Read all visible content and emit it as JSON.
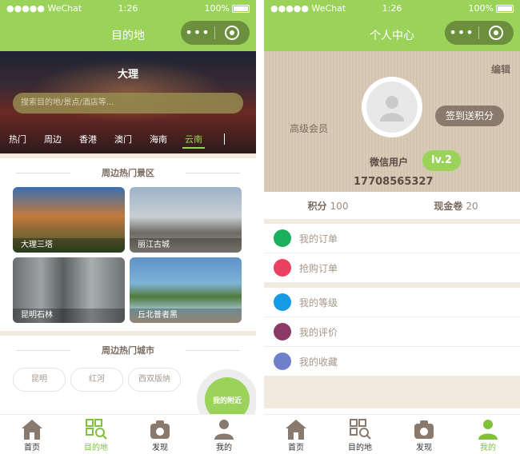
{
  "status": {
    "carrier": "●●●●● WeChat",
    "time": "1:26",
    "battery": "100%"
  },
  "capsule": {
    "more": "•••"
  },
  "screen1": {
    "nav_title": "目的地",
    "hero": {
      "city": "大理",
      "search_placeholder": "搜索目的地/景点/酒店等...",
      "tabs": [
        "热门",
        "周边",
        "香港",
        "澳门",
        "海南",
        "云南"
      ],
      "active_tab": "云南"
    },
    "scenic_title": "周边热门景区",
    "scenic": [
      "大理三塔",
      "丽江古城",
      "昆明石林",
      "丘北普者黑"
    ],
    "cities_title": "周边热门城市",
    "cities": [
      "昆明",
      "红河",
      "西双版纳"
    ],
    "fab_label": "我的附近"
  },
  "screen2": {
    "nav_title": "个人中心",
    "edit_label": "编辑",
    "member_label": "高级会员",
    "signin_label": "签到送积分",
    "username": "微信用户",
    "level": "lv.2",
    "phone": "17708565327",
    "points_label": "积分",
    "points_value": "100",
    "coupon_label": "现金卷",
    "coupon_value": "20",
    "menu_group1": [
      {
        "label": "我的订单",
        "color": "#1aaf5d"
      },
      {
        "label": "抢购订单",
        "color": "#e9415f"
      }
    ],
    "menu_group2": [
      {
        "label": "我的等级",
        "color": "#169ae5"
      },
      {
        "label": "我的评价",
        "color": "#8b3a66"
      },
      {
        "label": "我的收藏",
        "color": "#6f7fc9"
      }
    ]
  },
  "tabbar": {
    "items": [
      "首页",
      "目的地",
      "发现",
      "我的"
    ],
    "active_screen1": "目的地",
    "active_screen2": "我的",
    "accent": "#7fc23a",
    "icon_color": "#8a7a6d"
  }
}
